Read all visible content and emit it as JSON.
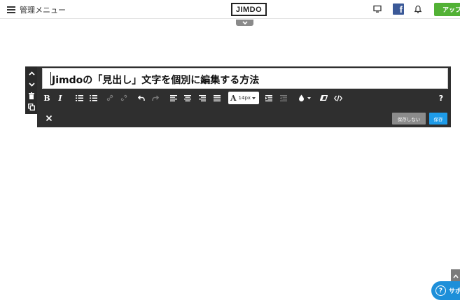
{
  "topbar": {
    "menu_label": "管理メニュー",
    "logo_text": "JIMDO",
    "facebook_letter": "f",
    "upgrade_label": "アップ"
  },
  "editor": {
    "heading_text": "Jimdoの「見出し」文字を個別に編集する方法",
    "toolbar": {
      "bold": "B",
      "italic": "I",
      "font_size_symbol": "A",
      "font_size_value": "14px",
      "help": "?"
    },
    "actions": {
      "discard_label": "保存しない",
      "save_label": "保存"
    }
  },
  "support": {
    "label": "サポ"
  },
  "colors": {
    "toolbar_bg": "#2f2f2f",
    "save_blue": "#1e9be8",
    "upgrade_green": "#52b135",
    "facebook_blue": "#3b5998"
  }
}
